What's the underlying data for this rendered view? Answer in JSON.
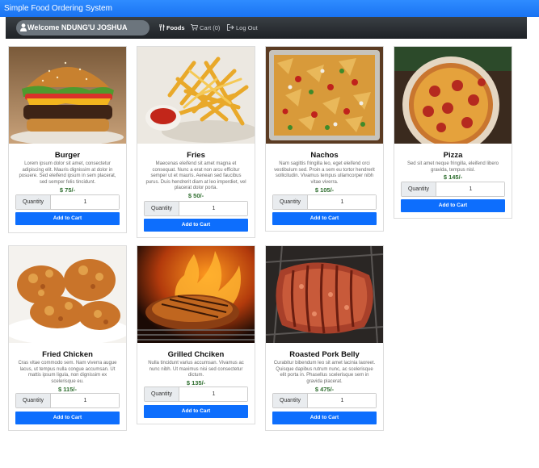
{
  "app": {
    "title": "Simple Food Ordering System"
  },
  "nav": {
    "welcome": "Welcome NDUNG'U JOSHUA",
    "foods": "Foods",
    "cart": "Cart (0)",
    "logout": "Log Out"
  },
  "products": [
    {
      "name": "Burger",
      "description": "Lorem ipsum dolor sit amet, consectetur adipiscing elit. Mauris dignissim at dolor in posuere. Sed eleifend ipsum in sem placerat, sed semper felis tincidunt.",
      "price": "$ 75/-",
      "qty_label": "Quantity",
      "qty_value": "1",
      "button": "Add to Cart",
      "image": "burger"
    },
    {
      "name": "Fries",
      "description": "Maecenas eleifend sit amet magna et consequat. Nunc a erat non arcu efficitur semper ut et mauris. Aenean sed faucibus purus. Duis hendrerit diam at leo imperdiet, vel placerat dolor porta.",
      "price": "$ 50/-",
      "qty_label": "Quantity",
      "qty_value": "1",
      "button": "Add to Cart",
      "image": "fries"
    },
    {
      "name": "Nachos",
      "description": "Nam sagittis fringilla leo, eget eleifend orci vestibulum sed. Proin a sem eu tortor hendrerit sollicitudin. Vivamus tempus ullamcorper nibh vitae viverra.",
      "price": "$ 105/-",
      "qty_label": "Quantity",
      "qty_value": "1",
      "button": "Add to Cart",
      "image": "nachos"
    },
    {
      "name": "Pizza",
      "description": "Sed sit amet neque fringilla, eleifend libero gravida, tempus nisl.",
      "price": "$ 145/-",
      "qty_label": "Quantity",
      "qty_value": "1",
      "button": "Add to Cart",
      "image": "pizza"
    },
    {
      "name": "Fried Chicken",
      "description": "Cras vitae commodo sem. Nam viverra augue lacus, ut tempus nulla congue accumsan. Ut mattis ipsum ligula, non dignissim ex scelerisque eu.",
      "price": "$ 115/-",
      "qty_label": "Quantity",
      "qty_value": "1",
      "button": "Add to Cart",
      "image": "fried-chicken"
    },
    {
      "name": "Grilled Chciken",
      "description": "Nulla tincidunt varius accumsan. Vivamus ac nunc nibh. Ut maximus nisi sed consectetur dictum.",
      "price": "$ 135/-",
      "qty_label": "Quantity",
      "qty_value": "1",
      "button": "Add to Cart",
      "image": "grilled-chicken"
    },
    {
      "name": "Roasted Pork Belly",
      "description": "Curabitur bibendum leo sit amet lacinia laoreet. Quisque dapibus rutrum nunc, ac scelerisque elit porta in. Phasellus scelerisque sem in gravida placerat.",
      "price": "$ 475/-",
      "qty_label": "Quantity",
      "qty_value": "1",
      "button": "Add to Cart",
      "image": "pork-belly"
    }
  ],
  "colors": {
    "topbar": "#1a73f2",
    "navbar": "#2b2f33",
    "button": "#0d6efd",
    "price": "#2f6e2f"
  }
}
